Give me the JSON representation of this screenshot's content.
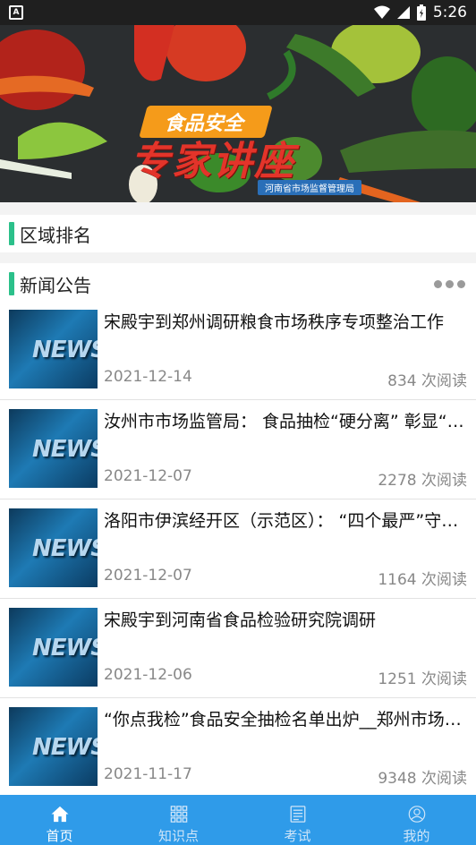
{
  "status_bar": {
    "time": "5:26",
    "notification_icon": "A"
  },
  "banner": {
    "tag": "食品安全",
    "title": "专家讲座",
    "subtitle": "河南省市场监督管理局",
    "dots": 5,
    "active_dot": 4
  },
  "region": {
    "title": "区域排名"
  },
  "news": {
    "title": "新闻公告",
    "thumb_text": "NEWS",
    "items": [
      {
        "title": "宋殿宇到郑州调研粮食市场秩序专项整治工作",
        "date": "2021-12-14",
        "reads": "834 次阅读"
      },
      {
        "title": "汝州市市场监管局： 食品抽检“硬分离” 彰显“真公正”",
        "date": "2021-12-07",
        "reads": "2278 次阅读"
      },
      {
        "title": "洛阳市伊滨经开区（示范区）： “四个最严”守护食品安全",
        "date": "2021-12-07",
        "reads": "1164 次阅读"
      },
      {
        "title": "宋殿宇到河南省食品检验研究院调研",
        "date": "2021-12-06",
        "reads": "1251 次阅读"
      },
      {
        "title": "“你点我检”食品安全抽检名单出炉__郑州市场监管",
        "date": "2021-11-17",
        "reads": "9348 次阅读"
      }
    ]
  },
  "tabs": [
    {
      "label": "首页",
      "icon": "home-icon",
      "active": true
    },
    {
      "label": "知识点",
      "icon": "grid-icon",
      "active": false
    },
    {
      "label": "考试",
      "icon": "document-icon",
      "active": false
    },
    {
      "label": "我的",
      "icon": "user-icon",
      "active": false
    }
  ]
}
